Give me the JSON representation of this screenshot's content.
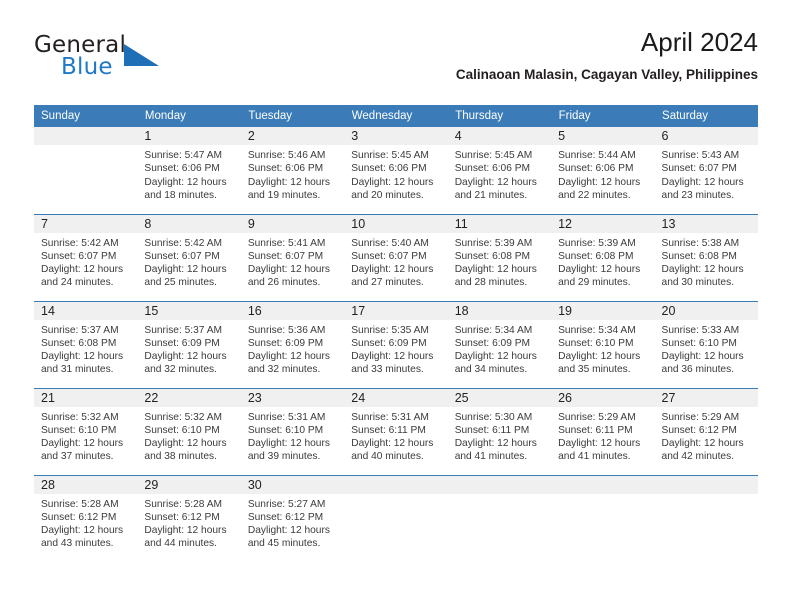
{
  "logo": {
    "word_one": "General",
    "word_two": "Blue",
    "icon": "triangle-logo-icon",
    "accent_color": "#1f6fb7"
  },
  "header": {
    "month_title": "April 2024",
    "location": "Calinaoan Malasin, Cagayan Valley, Philippines"
  },
  "theme": {
    "header_blue": "#3a7bb8",
    "daynum_band": "#f0f0f0",
    "text": "#231f20"
  },
  "calendar": {
    "weekday_headers": [
      "Sunday",
      "Monday",
      "Tuesday",
      "Wednesday",
      "Thursday",
      "Friday",
      "Saturday"
    ],
    "labels": {
      "sunrise": "Sunrise:",
      "sunset": "Sunset:",
      "daylight": "Daylight:"
    },
    "weeks": [
      [
        {
          "blank": true,
          "day": "",
          "sunrise": "",
          "sunset": "",
          "daylight_1": "",
          "daylight_2": ""
        },
        {
          "blank": false,
          "day": "1",
          "sunrise": "Sunrise: 5:47 AM",
          "sunset": "Sunset: 6:06 PM",
          "daylight_1": "Daylight: 12 hours",
          "daylight_2": "and 18 minutes."
        },
        {
          "blank": false,
          "day": "2",
          "sunrise": "Sunrise: 5:46 AM",
          "sunset": "Sunset: 6:06 PM",
          "daylight_1": "Daylight: 12 hours",
          "daylight_2": "and 19 minutes."
        },
        {
          "blank": false,
          "day": "3",
          "sunrise": "Sunrise: 5:45 AM",
          "sunset": "Sunset: 6:06 PM",
          "daylight_1": "Daylight: 12 hours",
          "daylight_2": "and 20 minutes."
        },
        {
          "blank": false,
          "day": "4",
          "sunrise": "Sunrise: 5:45 AM",
          "sunset": "Sunset: 6:06 PM",
          "daylight_1": "Daylight: 12 hours",
          "daylight_2": "and 21 minutes."
        },
        {
          "blank": false,
          "day": "5",
          "sunrise": "Sunrise: 5:44 AM",
          "sunset": "Sunset: 6:06 PM",
          "daylight_1": "Daylight: 12 hours",
          "daylight_2": "and 22 minutes."
        },
        {
          "blank": false,
          "day": "6",
          "sunrise": "Sunrise: 5:43 AM",
          "sunset": "Sunset: 6:07 PM",
          "daylight_1": "Daylight: 12 hours",
          "daylight_2": "and 23 minutes."
        }
      ],
      [
        {
          "blank": false,
          "day": "7",
          "sunrise": "Sunrise: 5:42 AM",
          "sunset": "Sunset: 6:07 PM",
          "daylight_1": "Daylight: 12 hours",
          "daylight_2": "and 24 minutes."
        },
        {
          "blank": false,
          "day": "8",
          "sunrise": "Sunrise: 5:42 AM",
          "sunset": "Sunset: 6:07 PM",
          "daylight_1": "Daylight: 12 hours",
          "daylight_2": "and 25 minutes."
        },
        {
          "blank": false,
          "day": "9",
          "sunrise": "Sunrise: 5:41 AM",
          "sunset": "Sunset: 6:07 PM",
          "daylight_1": "Daylight: 12 hours",
          "daylight_2": "and 26 minutes."
        },
        {
          "blank": false,
          "day": "10",
          "sunrise": "Sunrise: 5:40 AM",
          "sunset": "Sunset: 6:07 PM",
          "daylight_1": "Daylight: 12 hours",
          "daylight_2": "and 27 minutes."
        },
        {
          "blank": false,
          "day": "11",
          "sunrise": "Sunrise: 5:39 AM",
          "sunset": "Sunset: 6:08 PM",
          "daylight_1": "Daylight: 12 hours",
          "daylight_2": "and 28 minutes."
        },
        {
          "blank": false,
          "day": "12",
          "sunrise": "Sunrise: 5:39 AM",
          "sunset": "Sunset: 6:08 PM",
          "daylight_1": "Daylight: 12 hours",
          "daylight_2": "and 29 minutes."
        },
        {
          "blank": false,
          "day": "13",
          "sunrise": "Sunrise: 5:38 AM",
          "sunset": "Sunset: 6:08 PM",
          "daylight_1": "Daylight: 12 hours",
          "daylight_2": "and 30 minutes."
        }
      ],
      [
        {
          "blank": false,
          "day": "14",
          "sunrise": "Sunrise: 5:37 AM",
          "sunset": "Sunset: 6:08 PM",
          "daylight_1": "Daylight: 12 hours",
          "daylight_2": "and 31 minutes."
        },
        {
          "blank": false,
          "day": "15",
          "sunrise": "Sunrise: 5:37 AM",
          "sunset": "Sunset: 6:09 PM",
          "daylight_1": "Daylight: 12 hours",
          "daylight_2": "and 32 minutes."
        },
        {
          "blank": false,
          "day": "16",
          "sunrise": "Sunrise: 5:36 AM",
          "sunset": "Sunset: 6:09 PM",
          "daylight_1": "Daylight: 12 hours",
          "daylight_2": "and 32 minutes."
        },
        {
          "blank": false,
          "day": "17",
          "sunrise": "Sunrise: 5:35 AM",
          "sunset": "Sunset: 6:09 PM",
          "daylight_1": "Daylight: 12 hours",
          "daylight_2": "and 33 minutes."
        },
        {
          "blank": false,
          "day": "18",
          "sunrise": "Sunrise: 5:34 AM",
          "sunset": "Sunset: 6:09 PM",
          "daylight_1": "Daylight: 12 hours",
          "daylight_2": "and 34 minutes."
        },
        {
          "blank": false,
          "day": "19",
          "sunrise": "Sunrise: 5:34 AM",
          "sunset": "Sunset: 6:10 PM",
          "daylight_1": "Daylight: 12 hours",
          "daylight_2": "and 35 minutes."
        },
        {
          "blank": false,
          "day": "20",
          "sunrise": "Sunrise: 5:33 AM",
          "sunset": "Sunset: 6:10 PM",
          "daylight_1": "Daylight: 12 hours",
          "daylight_2": "and 36 minutes."
        }
      ],
      [
        {
          "blank": false,
          "day": "21",
          "sunrise": "Sunrise: 5:32 AM",
          "sunset": "Sunset: 6:10 PM",
          "daylight_1": "Daylight: 12 hours",
          "daylight_2": "and 37 minutes."
        },
        {
          "blank": false,
          "day": "22",
          "sunrise": "Sunrise: 5:32 AM",
          "sunset": "Sunset: 6:10 PM",
          "daylight_1": "Daylight: 12 hours",
          "daylight_2": "and 38 minutes."
        },
        {
          "blank": false,
          "day": "23",
          "sunrise": "Sunrise: 5:31 AM",
          "sunset": "Sunset: 6:10 PM",
          "daylight_1": "Daylight: 12 hours",
          "daylight_2": "and 39 minutes."
        },
        {
          "blank": false,
          "day": "24",
          "sunrise": "Sunrise: 5:31 AM",
          "sunset": "Sunset: 6:11 PM",
          "daylight_1": "Daylight: 12 hours",
          "daylight_2": "and 40 minutes."
        },
        {
          "blank": false,
          "day": "25",
          "sunrise": "Sunrise: 5:30 AM",
          "sunset": "Sunset: 6:11 PM",
          "daylight_1": "Daylight: 12 hours",
          "daylight_2": "and 41 minutes."
        },
        {
          "blank": false,
          "day": "26",
          "sunrise": "Sunrise: 5:29 AM",
          "sunset": "Sunset: 6:11 PM",
          "daylight_1": "Daylight: 12 hours",
          "daylight_2": "and 41 minutes."
        },
        {
          "blank": false,
          "day": "27",
          "sunrise": "Sunrise: 5:29 AM",
          "sunset": "Sunset: 6:12 PM",
          "daylight_1": "Daylight: 12 hours",
          "daylight_2": "and 42 minutes."
        }
      ],
      [
        {
          "blank": false,
          "day": "28",
          "sunrise": "Sunrise: 5:28 AM",
          "sunset": "Sunset: 6:12 PM",
          "daylight_1": "Daylight: 12 hours",
          "daylight_2": "and 43 minutes."
        },
        {
          "blank": false,
          "day": "29",
          "sunrise": "Sunrise: 5:28 AM",
          "sunset": "Sunset: 6:12 PM",
          "daylight_1": "Daylight: 12 hours",
          "daylight_2": "and 44 minutes."
        },
        {
          "blank": false,
          "day": "30",
          "sunrise": "Sunrise: 5:27 AM",
          "sunset": "Sunset: 6:12 PM",
          "daylight_1": "Daylight: 12 hours",
          "daylight_2": "and 45 minutes."
        },
        {
          "blank": true,
          "day": "",
          "sunrise": "",
          "sunset": "",
          "daylight_1": "",
          "daylight_2": ""
        },
        {
          "blank": true,
          "day": "",
          "sunrise": "",
          "sunset": "",
          "daylight_1": "",
          "daylight_2": ""
        },
        {
          "blank": true,
          "day": "",
          "sunrise": "",
          "sunset": "",
          "daylight_1": "",
          "daylight_2": ""
        },
        {
          "blank": true,
          "day": "",
          "sunrise": "",
          "sunset": "",
          "daylight_1": "",
          "daylight_2": ""
        }
      ]
    ]
  }
}
